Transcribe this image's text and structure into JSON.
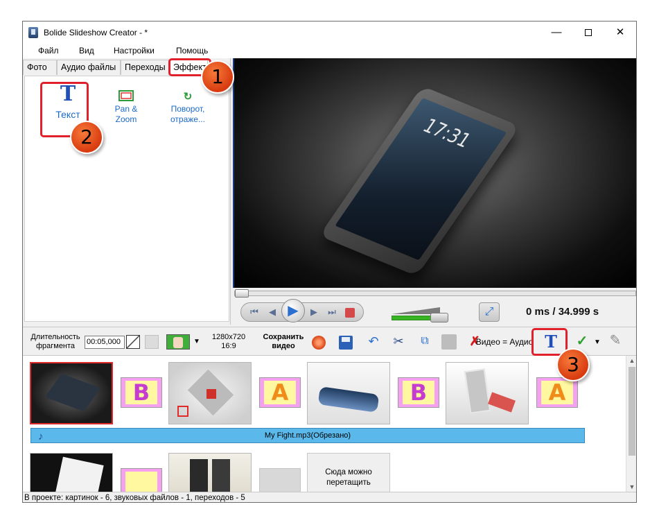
{
  "titlebar": {
    "title": "Bolide Slideshow Creator - *",
    "minimize": "—",
    "close": "✕"
  },
  "menu": [
    "Файл",
    "Вид",
    "Настройки",
    "Помощь"
  ],
  "tabs": [
    "Фото",
    "Аудио файлы",
    "Переходы",
    "Эффекты"
  ],
  "effects_panel": {
    "items": [
      {
        "label": "Текст",
        "icon": "text-T-icon"
      },
      {
        "label_line1": "Pan &",
        "label_line2": "Zoom",
        "icon": "pan-zoom-icon"
      },
      {
        "label_line1": "Поворот,",
        "label_line2": "отраже...",
        "icon": "rotate-icon"
      }
    ]
  },
  "badges": [
    "1",
    "2",
    "3"
  ],
  "preview": {
    "clock": "17:31"
  },
  "player": {
    "time_current": "0 ms",
    "time_total": " / 34.999 s",
    "buttons": [
      "skip-start",
      "prev-frame",
      "play",
      "next-frame",
      "skip-end",
      "stop"
    ]
  },
  "toolbar": {
    "duration_label_line1": "Длительность",
    "duration_label_line2": "фрагмента",
    "duration_value": "00:05,000",
    "resolution_line1": "1280x720",
    "resolution_line2": "16:9",
    "save_video_line1": "Сохранить",
    "save_video_line2": "видео",
    "video_eq_audio": "Видео = Аудио"
  },
  "timeline": {
    "audio_track": "My Fight.mp3(Обрезано)",
    "transitions": [
      "B",
      "A",
      "B",
      "A"
    ],
    "drop_hint_line1": "Сюда можно",
    "drop_hint_line2": "перетащить"
  },
  "status_bar": "В проекте: картинок - 6, звуковых файлов - 1, переходов - 5",
  "colors": {
    "highlight": "#e0202a",
    "badge": "#e4521f",
    "audio_track": "#5ab9ea",
    "transition_bg": "#f5a0f0"
  }
}
